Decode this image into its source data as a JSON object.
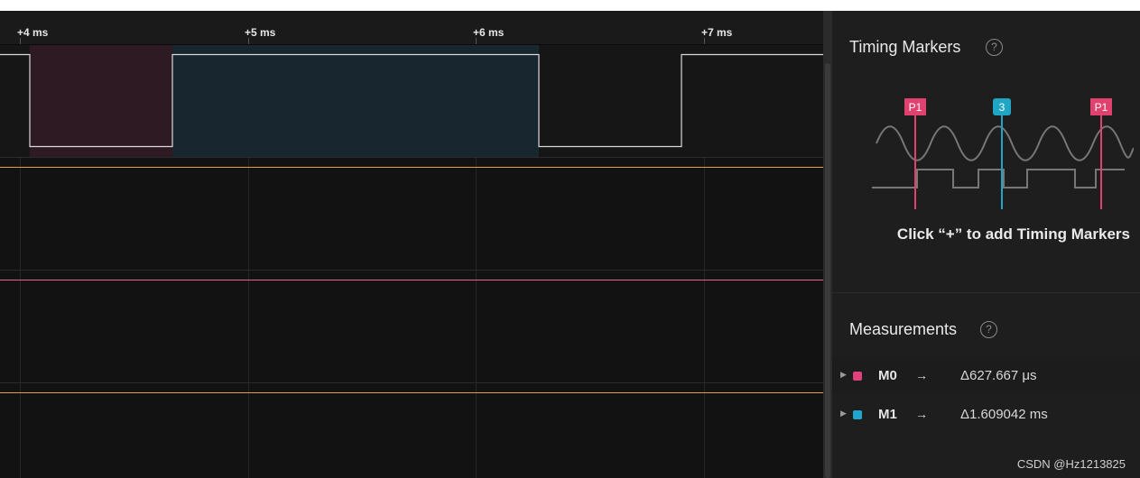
{
  "ruler": {
    "ticks": [
      "+4 ms",
      "+5 ms",
      "+6 ms",
      "+7 ms"
    ]
  },
  "timing_markers": {
    "title": "Timing Markers",
    "help_glyph": "?",
    "hint": "Click “+” to add Timing Markers",
    "illustration_markers": [
      "P1",
      "3",
      "P1"
    ]
  },
  "measurements": {
    "title": "Measurements",
    "help_glyph": "?",
    "items": [
      {
        "name": "M0",
        "arrow": "→",
        "value": "Δ627.667 μs",
        "color": "#e0417d"
      },
      {
        "name": "M1",
        "arrow": "→",
        "value": "Δ1.609042 ms",
        "color": "#1ea6d1"
      }
    ]
  },
  "colors": {
    "channel1_trace": "#d9d9d9",
    "channel2_trace": "#e0a13c",
    "channel3_trace": "#e0668a",
    "channel4_trace": "#e0a13c",
    "m0_highlight": "#2e1a22",
    "m1_highlight": "#17262f",
    "marker_pink": "#e0416f",
    "marker_cyan": "#1ea6c4"
  },
  "watermark": "CSDN @Hz1213825"
}
